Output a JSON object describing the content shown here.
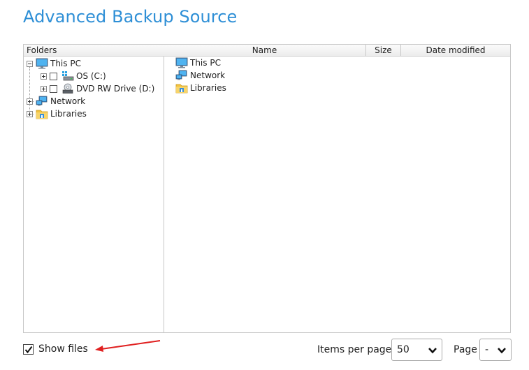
{
  "title": "Advanced Backup Source",
  "tree": {
    "header": "Folders",
    "nodes": [
      {
        "label": "This PC",
        "icon": "monitor-icon",
        "expanded": true
      },
      {
        "label": "OS (C:)",
        "icon": "windows-drive-icon",
        "checked": false
      },
      {
        "label": "DVD RW Drive (D:)",
        "icon": "dvd-drive-icon",
        "checked": false
      },
      {
        "label": "Network",
        "icon": "network-icon",
        "expanded": false
      },
      {
        "label": "Libraries",
        "icon": "libraries-folder-icon",
        "expanded": false
      }
    ]
  },
  "list": {
    "columns": [
      "Name",
      "Size",
      "Date modified"
    ],
    "items": [
      {
        "name": "This PC",
        "icon": "monitor-icon"
      },
      {
        "name": "Network",
        "icon": "network-icon"
      },
      {
        "name": "Libraries",
        "icon": "libraries-folder-icon"
      }
    ]
  },
  "footer": {
    "show_files_label": "Show files",
    "show_files_checked": true,
    "items_per_page_label": "Items per page",
    "items_per_page_value": "50",
    "page_label": "Page",
    "page_value": "-"
  },
  "colors": {
    "title": "#2e8fd6",
    "annotation_arrow": "#e02020"
  }
}
